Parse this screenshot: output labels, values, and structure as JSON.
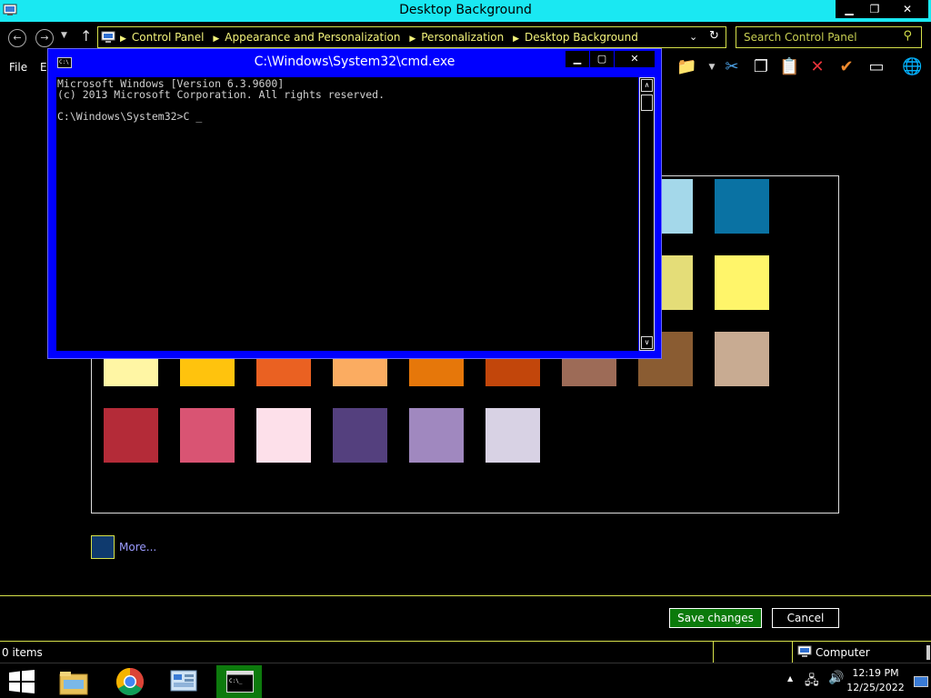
{
  "window": {
    "title": "Desktop Background"
  },
  "address": {
    "crumbs": [
      "Control Panel",
      "Appearance and Personalization",
      "Personalization",
      "Desktop Background"
    ]
  },
  "search": {
    "placeholder": "Search Control Panel"
  },
  "menu": {
    "file": "File",
    "edit": "E"
  },
  "swatches": [
    {
      "color": "#a4d8ea"
    },
    {
      "color": "#0a72a3"
    },
    {
      "color": "#e4dd78"
    },
    {
      "color": "#fff56a"
    },
    {
      "color": "#8a5c32"
    },
    {
      "color": "#c8ab92"
    },
    {
      "color": "#fff6a4"
    },
    {
      "color": "#ffc30d"
    },
    {
      "color": "#ea6122"
    },
    {
      "color": "#fbac61"
    },
    {
      "color": "#e6770a"
    },
    {
      "color": "#c2460b"
    },
    {
      "color": "#9d6b57"
    },
    {
      "color": "#b42b38"
    },
    {
      "color": "#d95473"
    },
    {
      "color": "#fde0ea"
    },
    {
      "color": "#54407e"
    },
    {
      "color": "#a088bf"
    },
    {
      "color": "#d8d2e4"
    }
  ],
  "more": {
    "label": "More...",
    "color": "#0f3a6e"
  },
  "buttons": {
    "save": "Save changes",
    "cancel": "Cancel"
  },
  "status": {
    "items": "0 items",
    "location": "Computer"
  },
  "cmd": {
    "title": "C:\\Windows\\System32\\cmd.exe",
    "icon_text": "C:\\",
    "lines": "Microsoft Windows [Version 6.3.9600]\n(c) 2013 Microsoft Corporation. All rights reserved.\n\nC:\\Windows\\System32>C _"
  },
  "clock": {
    "time": "12:19 PM",
    "date": "12/25/2022"
  },
  "colors": {
    "accent": "#1ae8f2",
    "highlight": "#d6e14a",
    "cmd_frame": "#0000ff",
    "active_task": "#0d7a0d"
  }
}
